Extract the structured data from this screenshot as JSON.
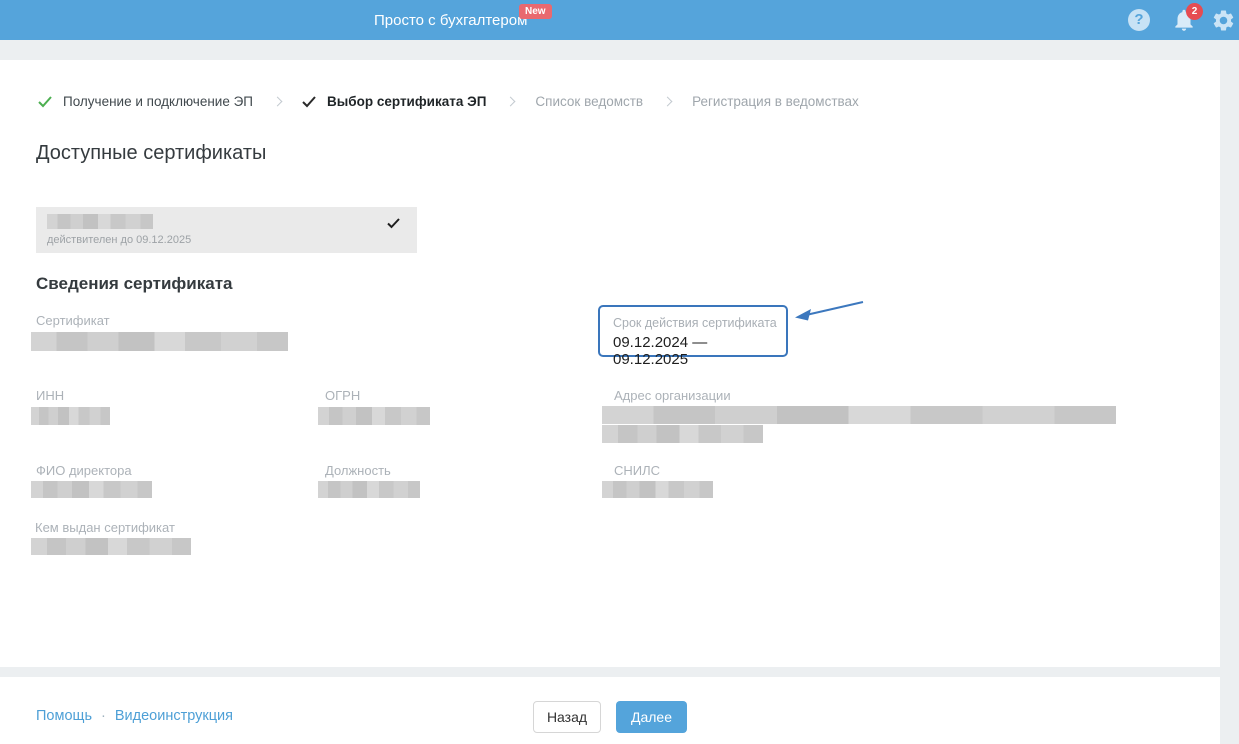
{
  "header": {
    "title": "Просто с бухгалтером",
    "new_badge": "New",
    "notifications_count": "2",
    "icons": {
      "help_glyph": "?",
      "help": "help-icon",
      "notifications": "bell-icon",
      "settings": "gear-icon"
    }
  },
  "stepper": {
    "separator_icon": "chevron-right",
    "steps": [
      {
        "label": "Получение и подключение ЭП",
        "state": "completed",
        "icon": "check-green"
      },
      {
        "label": "Выбор сертификата ЭП",
        "state": "current",
        "icon": "check-black"
      },
      {
        "label": "Список ведомств",
        "state": "upcoming"
      },
      {
        "label": "Регистрация в ведомствах",
        "state": "upcoming"
      }
    ]
  },
  "available_certificates": {
    "heading": "Доступные сертификаты",
    "certificates": [
      {
        "name_redacted": true,
        "validity": "действителен до 09.12.2025",
        "selected": true,
        "selected_icon": "check-black"
      }
    ]
  },
  "certificate_details": {
    "heading": "Сведения сертификата",
    "fields": [
      {
        "label": "Сертификат",
        "value_redacted": true
      },
      {
        "label": "Срок действия сертификата",
        "value": "09.12.2024 — 09.12.2025",
        "highlighted": true
      },
      {
        "label": "ИНН",
        "value_redacted": true
      },
      {
        "label": "ОГРН",
        "value_redacted": true
      },
      {
        "label": "Адрес организации",
        "value_redacted": true,
        "value_lines": 2
      },
      {
        "label": "ФИО директора",
        "value_redacted": true
      },
      {
        "label": "Должность",
        "value_redacted": true
      },
      {
        "label": "СНИЛС",
        "value_redacted": true
      },
      {
        "label": "Кем выдан сертификат",
        "value_redacted": true
      }
    ]
  },
  "footer": {
    "help_link": "Помощь",
    "link_separator": "·",
    "video_link": "Видеоинструкция",
    "back_button": "Назад",
    "next_button": "Далее"
  },
  "colors": {
    "header_bar": "#55A4DB",
    "highlight_border": "#3A76BC",
    "new_badge_red": "#E9696F",
    "notification_red": "#E64C52",
    "step_completed_check": "#4CAF50",
    "background_gray": "#ECEFF1",
    "card_gray": "#EAEAEA"
  }
}
